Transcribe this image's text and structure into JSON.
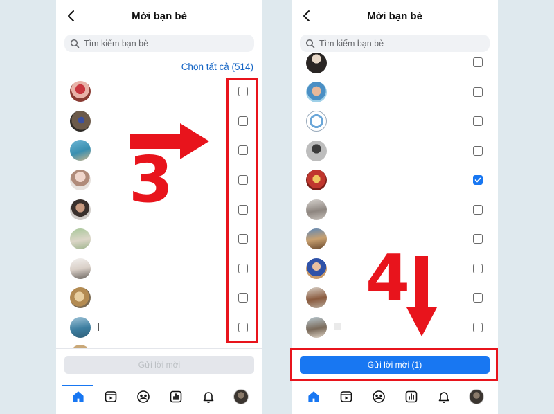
{
  "colors": {
    "accent": "#1877f2",
    "annotation": "#e8141c",
    "link": "#1666c5"
  },
  "left_screen": {
    "title": "Mời bạn bè",
    "search_placeholder": "Tìm kiếm bạn bè",
    "select_all_label": "Chọn tất cả (514)",
    "send_button_label": "Gửi lời mời",
    "friend_rows": [
      {
        "avatar": "avatar-1",
        "checked": false
      },
      {
        "avatar": "avatar-2",
        "checked": false
      },
      {
        "avatar": "avatar-3",
        "checked": false
      },
      {
        "avatar": "avatar-4",
        "checked": false
      },
      {
        "avatar": "avatar-5",
        "checked": false
      },
      {
        "avatar": "avatar-6",
        "checked": false
      },
      {
        "avatar": "avatar-7",
        "checked": false
      },
      {
        "avatar": "avatar-8",
        "checked": false
      },
      {
        "avatar": "avatar-9",
        "checked": false
      }
    ],
    "annotation_number": "3",
    "tabs": [
      "home-icon",
      "video-icon",
      "groups-icon",
      "dashboard-icon",
      "bell-icon",
      "profile-avatar"
    ]
  },
  "right_screen": {
    "title": "Mời bạn bè",
    "search_placeholder": "Tìm kiếm bạn bè",
    "send_button_label": "Gửi lời mời (1)",
    "friend_rows": [
      {
        "avatar": "avatar-a",
        "checked": false
      },
      {
        "avatar": "avatar-b",
        "checked": false
      },
      {
        "avatar": "avatar-c",
        "checked": false
      },
      {
        "avatar": "avatar-d",
        "checked": false
      },
      {
        "avatar": "avatar-e",
        "checked": true
      },
      {
        "avatar": "avatar-f",
        "checked": false
      },
      {
        "avatar": "avatar-g",
        "checked": false
      },
      {
        "avatar": "avatar-h",
        "checked": false
      },
      {
        "avatar": "avatar-i",
        "checked": false
      },
      {
        "avatar": "avatar-j",
        "checked": false
      }
    ],
    "annotation_number": "4",
    "tabs": [
      "home-icon",
      "video-icon",
      "groups-icon",
      "dashboard-icon",
      "bell-icon",
      "profile-avatar"
    ]
  }
}
